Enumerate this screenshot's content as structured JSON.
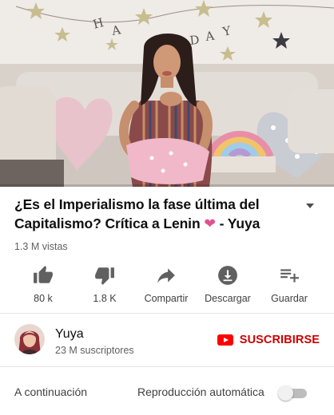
{
  "video": {
    "banner_text": "HAPPY BDAY",
    "progress": 0.0
  },
  "title": {
    "text_main": "¿Es el Imperialismo la fase última del Capitalismo? Crítica a Lenin",
    "heart": "❤",
    "text_suffix": " - Yuya"
  },
  "views": "1.3 M vistas",
  "actions": [
    {
      "icon": "thumbs-up-icon",
      "label": "80 k"
    },
    {
      "icon": "thumbs-down-icon",
      "label": "1.8 K"
    },
    {
      "icon": "share-icon",
      "label": "Compartir"
    },
    {
      "icon": "download-icon",
      "label": "Descargar"
    },
    {
      "icon": "playlist-add-icon",
      "label": "Guardar"
    }
  ],
  "channel": {
    "name": "Yuya",
    "subscribers": "23 M suscriptores",
    "subscribe_label": "SUSCRIBIRSE"
  },
  "up_next": {
    "label": "A continuación",
    "autoplay_label": "Reproducción automática",
    "autoplay_on": false
  },
  "colors": {
    "accent_red": "#ff0000",
    "subscribe_red": "#cc0000",
    "heart_pink": "#e2518e"
  }
}
